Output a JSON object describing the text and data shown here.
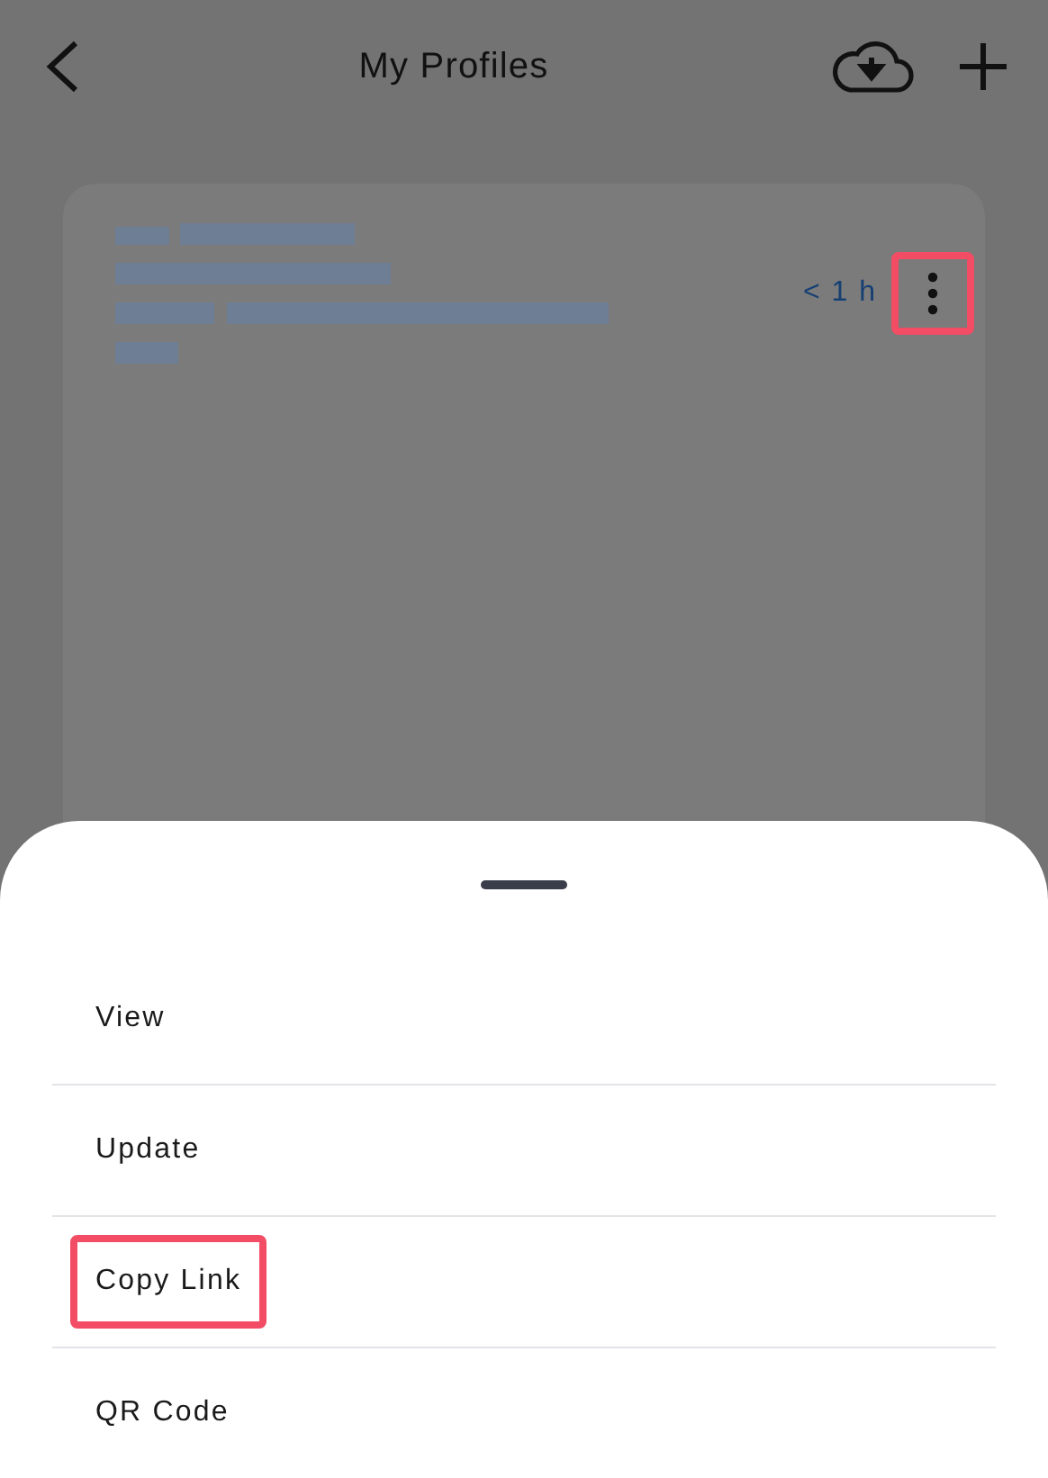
{
  "header": {
    "title": "My Profiles"
  },
  "profile_card": {
    "time": "< 1 h",
    "menu_highlighted": true
  },
  "action_sheet": {
    "items": [
      {
        "label": "View",
        "highlighted": false
      },
      {
        "label": "Update",
        "highlighted": false
      },
      {
        "label": "Copy Link",
        "highlighted": true
      },
      {
        "label": "QR Code",
        "highlighted": false
      }
    ]
  }
}
